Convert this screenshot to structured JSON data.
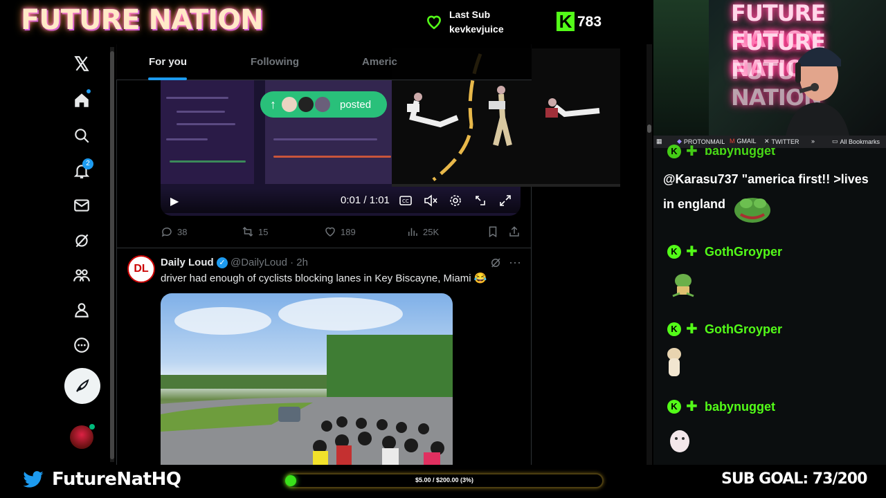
{
  "overlay": {
    "logo_text": "FUTURE NATION",
    "last_sub_title": "Last Sub",
    "last_sub_name": "kevkevjuice",
    "kick_count": "783",
    "colors": {
      "kick_green": "#53fc18",
      "x_blue": "#1d9bf0"
    }
  },
  "x": {
    "tabs": [
      {
        "label": "For you",
        "active": true
      },
      {
        "label": "Following",
        "active": false
      },
      {
        "label": "Americ",
        "active": false
      }
    ],
    "nav_icons": [
      "x-logo-icon",
      "home-icon",
      "search-icon",
      "notifications-icon",
      "messages-icon",
      "grok-icon",
      "communities-icon",
      "profile-icon",
      "more-icon"
    ],
    "notifications_badge": "2",
    "post1": {
      "posted_pill_label": "posted",
      "video_time": "0:01 / 1:01",
      "replies": "38",
      "reposts": "15",
      "likes": "189",
      "views": "25K"
    },
    "post2": {
      "avatar_text": "DL",
      "author": "Daily Loud",
      "handle": "@DailyLoud · 2h",
      "text": "driver had enough of cyclists blocking lanes in Key Biscayne, Miami 😂"
    }
  },
  "webcam": {
    "neon_lines": [
      "FUTURE NATION",
      "FUTURE NATION",
      "FUTURE NATION"
    ]
  },
  "bookmarks": {
    "items": [
      "PROTONMAIL",
      "GMAIL",
      "TWITTER"
    ],
    "more": "»",
    "all": "All Bookmarks"
  },
  "chat": {
    "top_name": "babynugget",
    "message1": "@Karasu737 \"america first!! >lives in england",
    "entries": [
      {
        "name": "GothGroyper",
        "emote": "frog"
      },
      {
        "name": "GothGroyper",
        "emote": "cat"
      },
      {
        "name": "babynugget",
        "emote": "hamster"
      }
    ]
  },
  "bottom": {
    "twitter_handle": "FutureNatHQ",
    "goal_text": "$5.00 / $200.00 (3%)",
    "goal_fraction": 0.03,
    "sub_goal": "SUB GOAL: 73/200"
  }
}
